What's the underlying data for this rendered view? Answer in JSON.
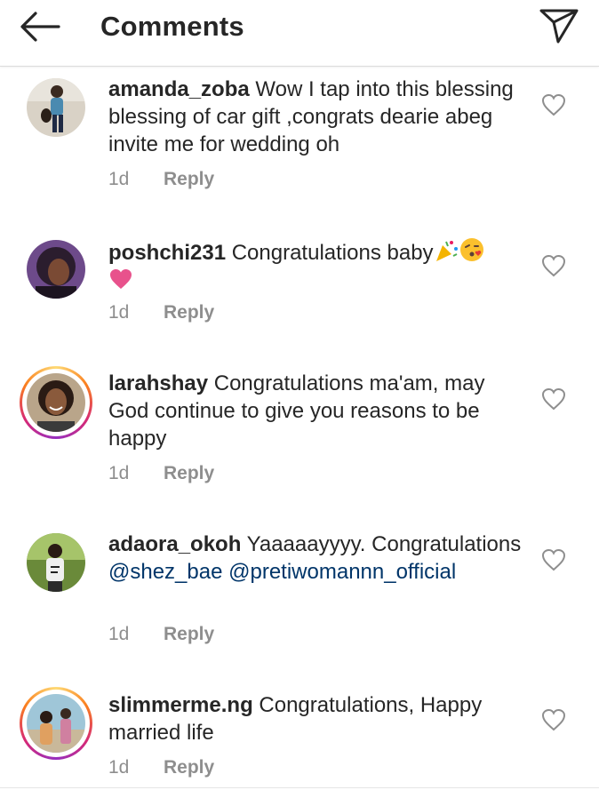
{
  "header": {
    "title": "Comments",
    "back_icon": "arrow-left-icon",
    "send_icon": "paper-plane-icon"
  },
  "comments": [
    {
      "username": "amanda_zoba",
      "text": "Wow I tap into this blessing blessing of car gift ,congrats dearie abeg invite me for wedding oh",
      "time": "1d",
      "reply": "Reply",
      "story_ring": false
    },
    {
      "username": "poshchi231",
      "text": "Congratulations baby",
      "emojis": [
        "party-popper-emoji",
        "kissing-face-emoji",
        "pink-heart-emoji"
      ],
      "time": "1d",
      "reply": "Reply",
      "story_ring": false
    },
    {
      "username": "larahshay",
      "text": "Congratulations ma'am, may God continue to give you reasons to be happy",
      "time": "1d",
      "reply": "Reply",
      "story_ring": true
    },
    {
      "username": "adaora_okoh",
      "text": "Yaaaaayyyy. Congratulations",
      "mentions": [
        "@shez_bae",
        "@pretiwomannn_official"
      ],
      "time": "1d",
      "reply": "Reply",
      "story_ring": false
    },
    {
      "username": "slimmerme.ng",
      "text": "Congratulations, Happy married life",
      "time": "1d",
      "reply": "Reply",
      "story_ring": true
    }
  ],
  "colors": {
    "text": "#262626",
    "meta": "#8e8e8e",
    "mention": "#003569",
    "divider": "#dbdbdb"
  }
}
